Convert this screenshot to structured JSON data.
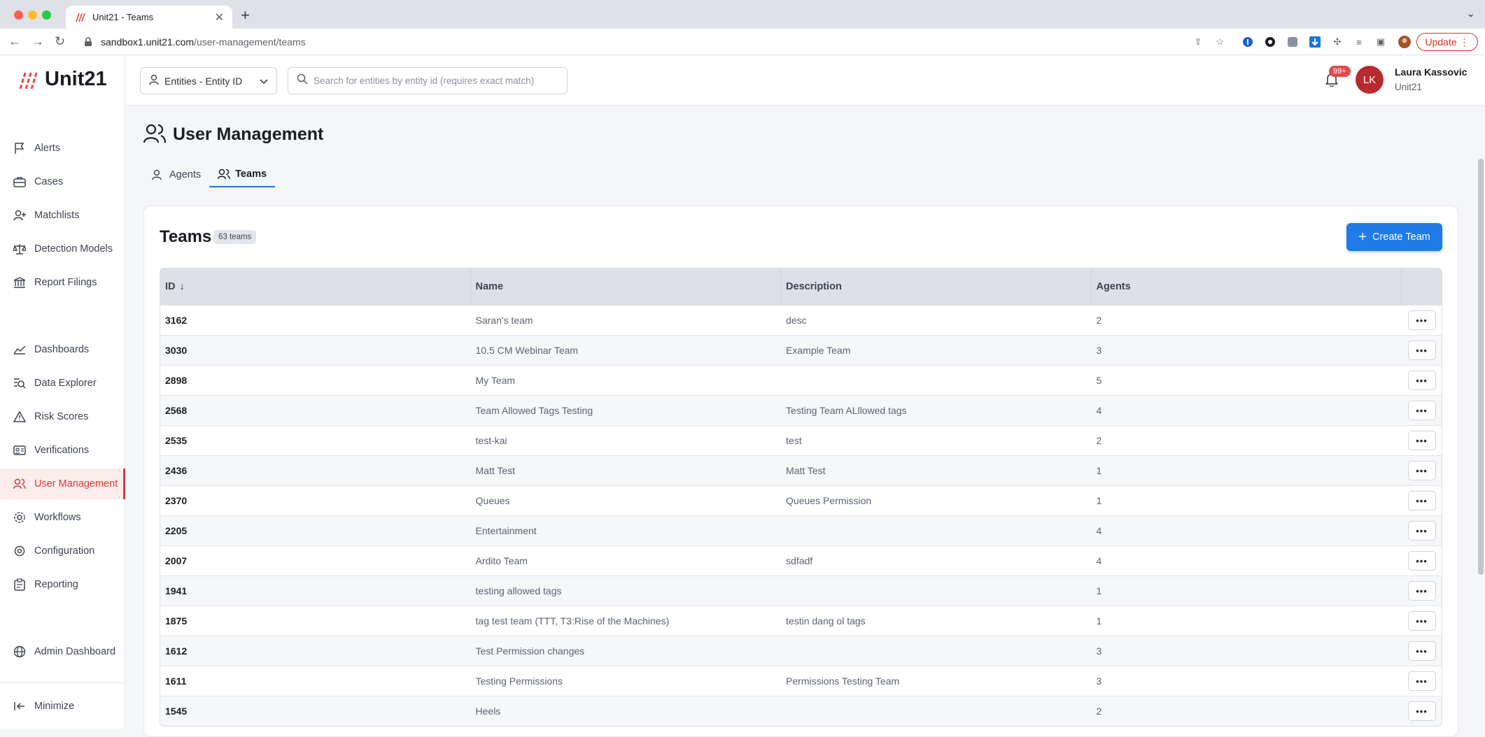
{
  "browser": {
    "tab_title": "Unit21 - Teams",
    "url_host": "sandbox1.unit21.com",
    "url_path": "/user-management/teams",
    "update_label": "Update"
  },
  "sidebar": {
    "logo": "Unit21",
    "items": [
      {
        "label": "Alerts",
        "icon": "flag-icon"
      },
      {
        "label": "Cases",
        "icon": "briefcase-icon"
      },
      {
        "label": "Matchlists",
        "icon": "user-plus-icon"
      },
      {
        "label": "Detection Models",
        "icon": "scale-icon"
      },
      {
        "label": "Report Filings",
        "icon": "bank-icon"
      },
      {
        "label": "Dashboards",
        "icon": "chart-line-icon"
      },
      {
        "label": "Data Explorer",
        "icon": "data-search-icon"
      },
      {
        "label": "Risk Scores",
        "icon": "warning-icon"
      },
      {
        "label": "Verifications",
        "icon": "id-card-icon"
      },
      {
        "label": "User Management",
        "icon": "users-icon"
      },
      {
        "label": "Workflows",
        "icon": "cog-flow-icon"
      },
      {
        "label": "Configuration",
        "icon": "gear-icon"
      },
      {
        "label": "Reporting",
        "icon": "clipboard-icon"
      },
      {
        "label": "Admin Dashboard",
        "icon": "globe-icon"
      }
    ],
    "minimize_label": "Minimize",
    "accent": "#d13c3c"
  },
  "topbar": {
    "entity_select": "Entities - Entity ID",
    "search_placeholder": "Search for entities by entity id (requires exact match)",
    "notifications": "99+",
    "user_initials": "LK",
    "user_name": "Laura Kassovic",
    "user_org": "Unit21"
  },
  "page": {
    "title": "User Management",
    "tabs": [
      {
        "label": "Agents"
      },
      {
        "label": "Teams"
      }
    ],
    "active_tab": "Teams"
  },
  "teams": {
    "title": "Teams",
    "count": "63 teams",
    "create_label": "Create Team",
    "accent": "#1e7be8",
    "columns": [
      "ID",
      "Name",
      "Description",
      "Agents"
    ],
    "rows": [
      {
        "id": "3162",
        "name": "Saran's team",
        "description": "desc",
        "agents": "2"
      },
      {
        "id": "3030",
        "name": "10.5 CM Webinar Team",
        "description": "Example Team",
        "agents": "3"
      },
      {
        "id": "2898",
        "name": "My Team",
        "description": "",
        "agents": "5"
      },
      {
        "id": "2568",
        "name": "Team Allowed Tags Testing",
        "description": "Testing Team ALllowed tags",
        "agents": "4"
      },
      {
        "id": "2535",
        "name": "test-kai",
        "description": "test",
        "agents": "2"
      },
      {
        "id": "2436",
        "name": "Matt Test",
        "description": "Matt Test",
        "agents": "1"
      },
      {
        "id": "2370",
        "name": "Queues",
        "description": "Queues Permission",
        "agents": "1"
      },
      {
        "id": "2205",
        "name": "Entertainment",
        "description": "",
        "agents": "4"
      },
      {
        "id": "2007",
        "name": "Ardito Team",
        "description": "sdfadf",
        "agents": "4"
      },
      {
        "id": "1941",
        "name": "testing allowed tags",
        "description": "",
        "agents": "1"
      },
      {
        "id": "1875",
        "name": "tag test team (TTT, T3:Rise of the Machines)",
        "description": "testin dang ol tags",
        "agents": "1"
      },
      {
        "id": "1612",
        "name": "Test Permission changes",
        "description": "",
        "agents": "3"
      },
      {
        "id": "1611",
        "name": "Testing Permissions",
        "description": "Permissions Testing Team",
        "agents": "3"
      },
      {
        "id": "1545",
        "name": "Heels",
        "description": "",
        "agents": "2"
      }
    ]
  }
}
